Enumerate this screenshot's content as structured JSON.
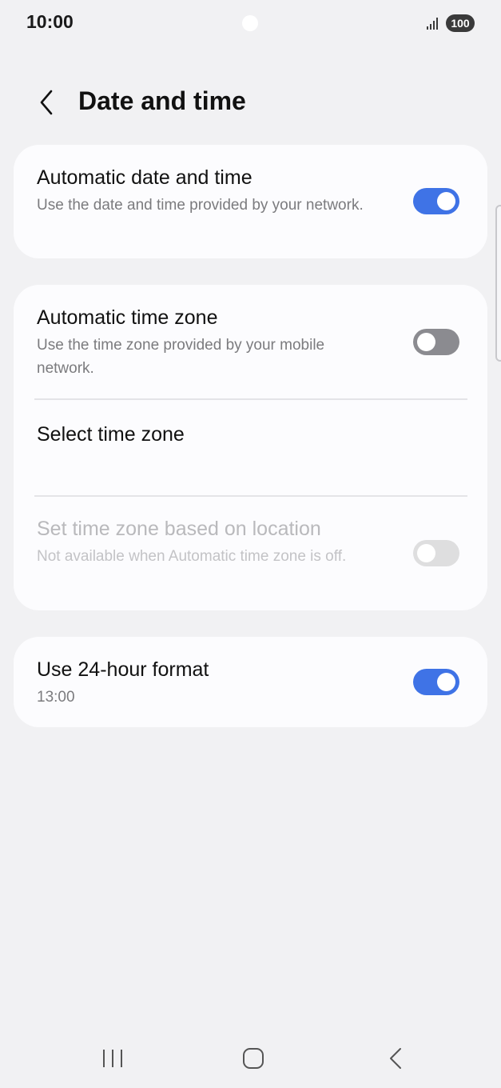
{
  "status_bar": {
    "time": "10:00",
    "battery": "100",
    "signal_icon": "signal-bars-icon"
  },
  "header": {
    "back_icon": "chevron-left-icon",
    "title": "Date and time"
  },
  "settings": {
    "automatic_date_time": {
      "title": "Automatic date and time",
      "subtitle": "Use the date and time provided by your network.",
      "enabled": true
    },
    "automatic_time_zone": {
      "title": "Automatic time zone",
      "subtitle": "Use the time zone provided by your mobile network.",
      "enabled": false
    },
    "select_time_zone": {
      "title": "Select time zone"
    },
    "location_time_zone": {
      "title": "Set time zone based on location",
      "subtitle": "Not available when Automatic time zone is off.",
      "enabled": false,
      "available": false
    },
    "use_24_hour": {
      "title": "Use 24-hour format",
      "subtitle": "13:00",
      "enabled": true
    }
  },
  "colors": {
    "background": "#f1f1f3",
    "card": "#fcfcfe",
    "toggle_on": "#3f73e6",
    "toggle_off": "#8b8b90"
  },
  "nav_bar": {
    "recents_icon": "recents-icon",
    "home_icon": "home-icon",
    "back_icon": "back-icon"
  }
}
